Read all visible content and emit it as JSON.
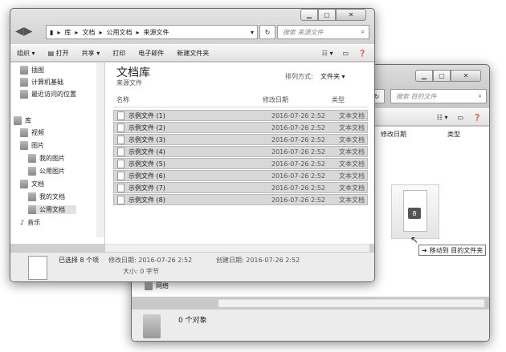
{
  "front": {
    "address": [
      "库",
      "文档",
      "公用文档",
      "来源文件"
    ],
    "search_placeholder": "搜索 来源文件",
    "toolbar": {
      "organize": "组织",
      "open": "打开",
      "share": "共享",
      "print": "打印",
      "email": "电子邮件",
      "new_folder": "新建文件夹"
    },
    "nav": [
      "插图",
      "计算机基础",
      "最近访问的位置",
      "库",
      "视频",
      "图片",
      "我的图片",
      "公用图片",
      "文档",
      "我的文档",
      "公用文档",
      "音乐"
    ],
    "library_title": "文档库",
    "library_sub": "来源文件",
    "sort_label": "排列方式:",
    "sort_value": "文件夹",
    "columns": {
      "name": "名称",
      "date": "修改日期",
      "type": "类型"
    },
    "files": [
      {
        "name": "示例文件 (1)",
        "date": "2016-07-26 2:52",
        "type": "文本文档"
      },
      {
        "name": "示例文件 (2)",
        "date": "2016-07-26 2:52",
        "type": "文本文档"
      },
      {
        "name": "示例文件 (3)",
        "date": "2016-07-26 2:52",
        "type": "文本文档"
      },
      {
        "name": "示例文件 (4)",
        "date": "2016-07-26 2:52",
        "type": "文本文档"
      },
      {
        "name": "示例文件 (5)",
        "date": "2016-07-26 2:52",
        "type": "文本文档"
      },
      {
        "name": "示例文件 (6)",
        "date": "2016-07-26 2:52",
        "type": "文本文档"
      },
      {
        "name": "示例文件 (7)",
        "date": "2016-07-26 2:52",
        "type": "文本文档"
      },
      {
        "name": "示例文件 (8)",
        "date": "2016-07-26 2:52",
        "type": "文本文档"
      }
    ],
    "status": {
      "selected": "已选择 8 个项",
      "modified": "修改日期: 2016-07-26 2:52",
      "created": "创建日期: 2016-07-26 2:52",
      "size": "大小: 0 字节"
    }
  },
  "back": {
    "search_placeholder": "搜索 目的文件",
    "columns": {
      "date": "修改日期",
      "type": "类型"
    },
    "network": "网络",
    "status": "0 个对象"
  },
  "drag": {
    "badge": "8",
    "tooltip": "移动到 目的文件夹"
  }
}
